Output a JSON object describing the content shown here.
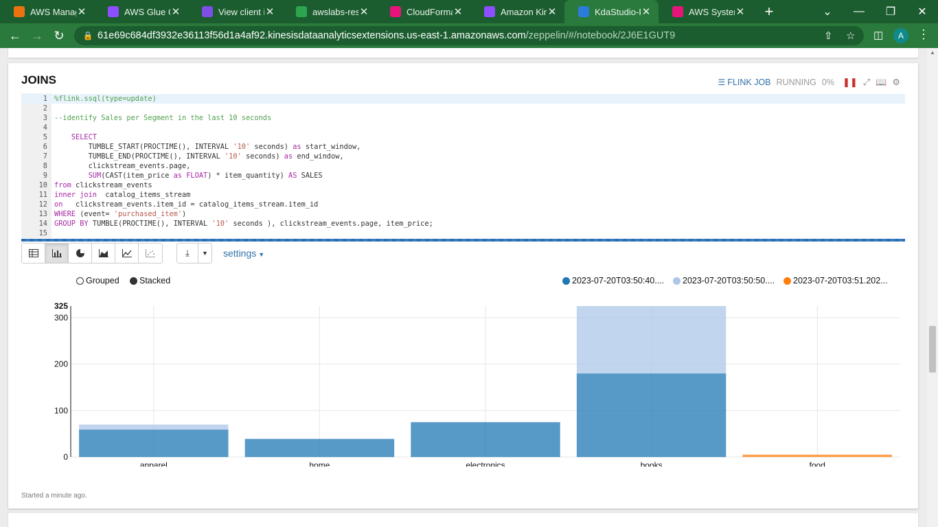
{
  "browser": {
    "tabs": [
      {
        "title": "AWS Manage",
        "icon": "aws-cube-icon",
        "color": "#ec7211"
      },
      {
        "title": "AWS Glue Co",
        "icon": "glue-icon",
        "color": "#8c4fff"
      },
      {
        "title": "View client in",
        "icon": "cloudshell-icon",
        "color": "#7d4ee8"
      },
      {
        "title": "awslabs-reso",
        "icon": "github-icon",
        "color": "#2da44e"
      },
      {
        "title": "CloudFormati",
        "icon": "cloudformation-icon",
        "color": "#e7157b"
      },
      {
        "title": "Amazon Kine",
        "icon": "kinesis-icon",
        "color": "#8c4fff"
      },
      {
        "title": "KdaStudio-FY",
        "icon": "zeppelin-icon",
        "color": "#2b7bd8"
      },
      {
        "title": "AWS Systems",
        "icon": "systems-manager-icon",
        "color": "#e7157b"
      }
    ],
    "active_tab": 6,
    "url_host": "61e69c684df3932e36113f56d1a4af92.kinesisdataanalyticsextensions.us-east-1.amazonaws.com",
    "url_path": "/zeppelin/#/notebook/2J6E1GUT9",
    "avatar_letter": "A"
  },
  "paragraph": {
    "title": "JOINS",
    "flink_job_label": "FLINK JOB",
    "status": "RUNNING",
    "progress": "0%",
    "footer": "Started a minute ago."
  },
  "code_lines": [
    "%flink.ssql(type=update)",
    "",
    "--identify Sales per Segment in the last 10 seconds",
    "",
    "    SELECT",
    "        TUMBLE_START(PROCTIME(), INTERVAL '10' seconds) as start_window,",
    "        TUMBLE_END(PROCTIME(), INTERVAL '10' seconds) as end_window,",
    "        clickstream_events.page,",
    "        SUM(CAST(item_price as FLOAT) * item_quantity) AS SALES",
    "from clickstream_events",
    "inner join  catalog_items_stream",
    "on   clickstream_events.item_id = catalog_items_stream.item_id",
    "WHERE (event= 'purchased_item')",
    "GROUP BY TUMBLE(PROCTIME(), INTERVAL '10' seconds ), clickstream_events.page, item_price;",
    ""
  ],
  "viz_toolbar": {
    "buttons": [
      "table-icon",
      "bar-chart-icon",
      "pie-chart-icon",
      "area-chart-icon",
      "line-chart-icon",
      "scatter-chart-icon"
    ],
    "active": "bar-chart-icon",
    "settings_label": "settings"
  },
  "chart_data": {
    "type": "bar",
    "mode_options": [
      "Grouped",
      "Stacked"
    ],
    "selected_mode": "Stacked",
    "categories": [
      "apparel",
      "home",
      "electronics",
      "books",
      "food"
    ],
    "series": [
      {
        "name": "2023-07-20T03:50:40....",
        "color": "#1f77b4",
        "values": [
          59,
          39,
          75,
          180,
          0
        ]
      },
      {
        "name": "2023-07-20T03:50:50....",
        "color": "#aec7e8",
        "values": [
          11,
          0,
          0,
          145,
          0
        ]
      },
      {
        "name": "2023-07-20T03:51.202...",
        "color": "#ff7f0e",
        "values": [
          0,
          0,
          0,
          0,
          5
        ]
      }
    ],
    "ylim": [
      0,
      325
    ],
    "yticks": [
      0,
      100,
      200,
      300
    ],
    "ymax_label": "325",
    "legend_position": "top-right",
    "grid": true
  }
}
